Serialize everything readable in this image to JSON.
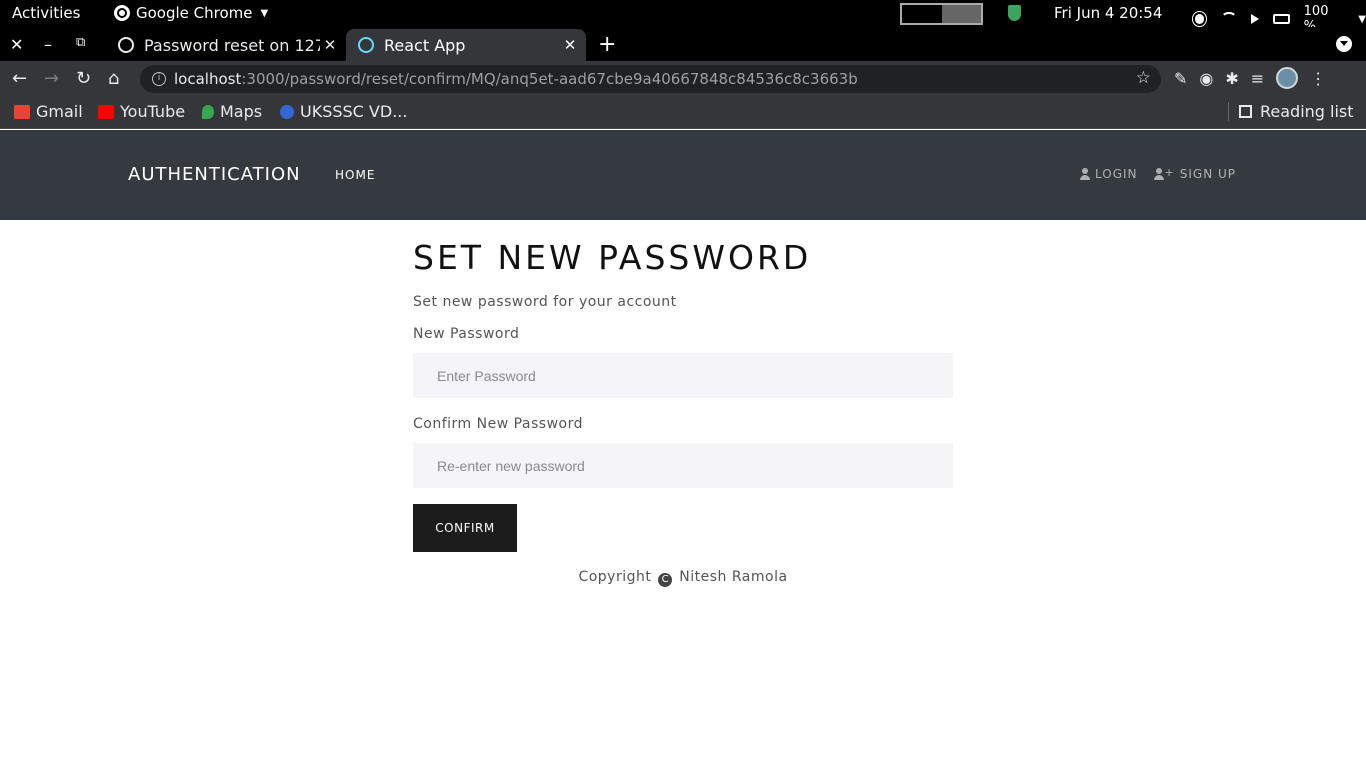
{
  "os": {
    "activities": "Activities",
    "app_name": "Google Chrome",
    "clock": "Fri Jun 4  20:54",
    "battery": "100 %"
  },
  "browser": {
    "tabs": [
      {
        "title": "Password reset on 127",
        "favicon": "github-icon"
      },
      {
        "title": "React App",
        "favicon": "react-icon",
        "active": true
      }
    ],
    "url_host": "localhost",
    "url_rest": ":3000/password/reset/confirm/MQ/anq5et-aad67cbe9a40667848c84536c8c3663b",
    "bookmarks": [
      {
        "label": "Gmail",
        "color": "#ea4335"
      },
      {
        "label": "YouTube",
        "color": "#ff0000"
      },
      {
        "label": "Maps",
        "color": "#34a853"
      },
      {
        "label": "UKSSSC VD...",
        "color": "#3367d6"
      }
    ],
    "reading_list": "Reading list"
  },
  "navbar": {
    "brand": "AUTHENTICATION",
    "home": "HOME",
    "login": "LOGIN",
    "signup": "SIGN UP"
  },
  "form": {
    "title": "SET NEW PASSWORD",
    "subtitle": "Set new password for your account",
    "new_password_label": "New Password",
    "new_password_placeholder": "Enter Password",
    "confirm_label": "Confirm New Password",
    "confirm_placeholder": "Re-enter new password",
    "submit": "CONFIRM"
  },
  "footer": {
    "prefix": "Copyright",
    "author": "Nitesh Ramola"
  }
}
